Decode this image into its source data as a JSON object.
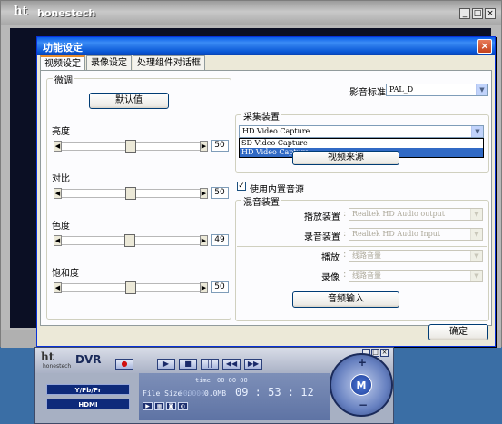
{
  "background_window": {
    "logo": "ht",
    "title": "honestech",
    "controls": [
      "_",
      "□",
      "×"
    ]
  },
  "dialog": {
    "title": "功能设定",
    "close_label": "×",
    "tabs": [
      "视频设定",
      "录像设定",
      "处理组件对话框"
    ],
    "fine_tune": {
      "group_label": "微调",
      "default_button": "默认值",
      "sliders": [
        {
          "label": "亮度",
          "value": "50",
          "level": 0.5
        },
        {
          "label": "对比",
          "value": "50",
          "level": 0.5
        },
        {
          "label": "色度",
          "value": "49",
          "level": 0.49
        },
        {
          "label": "饱和度",
          "value": "50",
          "level": 0.5
        }
      ]
    },
    "video_standard": {
      "label": "影音标准",
      "value": "PAL_D"
    },
    "capture": {
      "group_label": "采集装置",
      "selected": "HD Video Capture",
      "options": [
        "SD Video Capture",
        "HD Video Capture"
      ],
      "highlighted": "HD Video Capture",
      "video_source_button": "视频来源"
    },
    "internal_audio": {
      "label": "使用内置音源",
      "checked": true
    },
    "mixer": {
      "group_label": "混音装置",
      "playback_device_label": "播放装置",
      "playback_device_value": "Realtek HD Audio output",
      "record_device_label": "录音装置",
      "record_device_value": "Realtek HD Audio Input",
      "playback_label": "播放",
      "playback_value": "线路音量",
      "record_label": "录像",
      "record_value": "线路音量",
      "audio_input_button": "音频输入"
    },
    "ok_button": "确定"
  },
  "dvr": {
    "logo": "ht",
    "logo_sub": "honestech",
    "title": "DVR",
    "window_controls": [
      "_",
      "□",
      "×"
    ],
    "buttons": [
      "●",
      "▶",
      "■",
      "||",
      "◀◀",
      "▶▶"
    ],
    "chips": [
      "Y/Pb/Pr",
      "HDMI"
    ],
    "time_label": "time",
    "time_small": "00 00 00",
    "file_size_label": "File Size :",
    "file_size_value": "0.0MB",
    "file_size_prefix": "000000",
    "clock": "09 : 53 : 12",
    "mini_icons": [
      "▶",
      "▦",
      "◙",
      "◐"
    ],
    "knob_center": "M",
    "knob_plus": "+",
    "knob_minus": "−"
  },
  "colors": {
    "desktop": "#3a6ea5",
    "title_blue": "#0a5ee9",
    "selection": "#316ac5"
  }
}
